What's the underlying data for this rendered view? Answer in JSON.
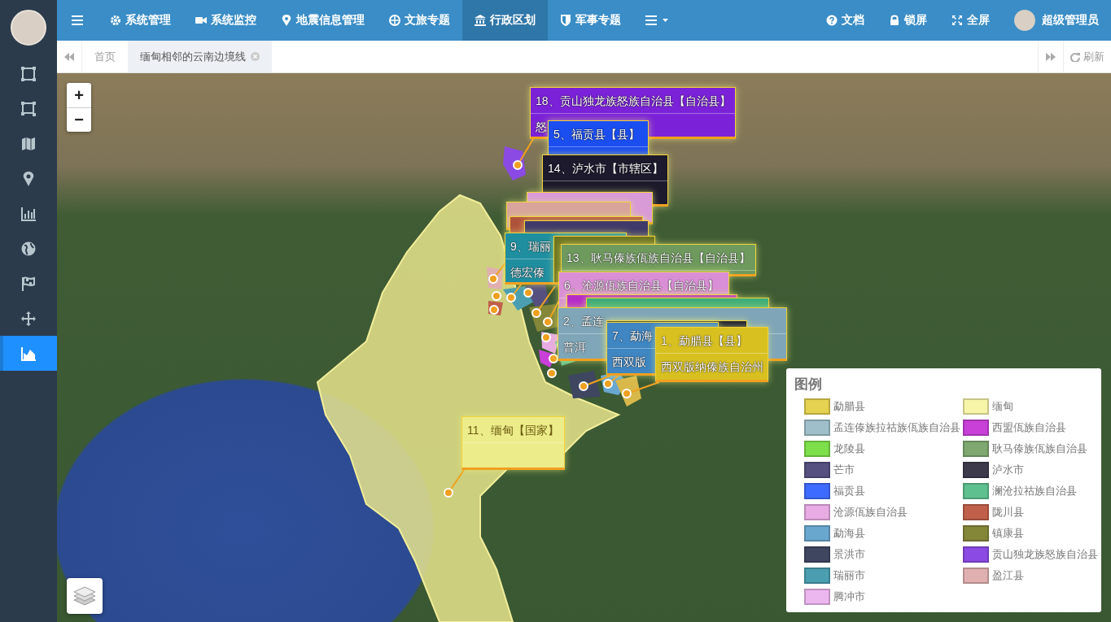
{
  "sidebar": {
    "items": [
      {
        "selected": false
      },
      {
        "selected": false
      },
      {
        "selected": false
      },
      {
        "selected": false
      },
      {
        "selected": false
      },
      {
        "selected": false
      },
      {
        "selected": false
      },
      {
        "selected": false
      },
      {
        "selected": true
      }
    ]
  },
  "topbar": {
    "menu_items": [
      {
        "label": "系统管理",
        "selected": false
      },
      {
        "label": "系统监控",
        "selected": false
      },
      {
        "label": "地震信息管理",
        "selected": false
      },
      {
        "label": "文旅专题",
        "selected": false
      },
      {
        "label": "行政区划",
        "selected": true
      },
      {
        "label": "军事专题",
        "selected": false
      }
    ],
    "right_links": [
      "文档",
      "锁屏",
      "全屏"
    ],
    "user": {
      "name": "超级管理员"
    }
  },
  "tabbar": {
    "tabs": [
      {
        "label": "首页",
        "selected": false,
        "closable": false
      },
      {
        "label": "缅甸相邻的云南边境线",
        "selected": true,
        "closable": true
      }
    ],
    "refresh": "刷新"
  },
  "map": {
    "zoom_in": "+",
    "zoom_out": "−",
    "popups": [
      {
        "title": "18、贡山独龙族怒族自治县【自治县】",
        "subtitle": "怒",
        "color": "#7b22d8"
      },
      {
        "title": "5、福贡县【县】",
        "color": "#1a4ef0"
      },
      {
        "title": "14、泸水市【市辖区】",
        "color": "#1c1a2c"
      },
      {
        "color": "#d99ad8"
      },
      {
        "color": "#d8a49c"
      },
      {
        "color": "#b0523c"
      },
      {
        "color": "#3f3a6a"
      },
      {
        "title": "9、瑞丽",
        "subtitle": "德宏傣",
        "color": "#1f8fa0"
      },
      {
        "color": "#6e7420"
      },
      {
        "title": "13、耿马傣族佤族自治县【自治县】",
        "color": "#6f9a5e"
      },
      {
        "title": "6、沧源佤族自治县【自治县】",
        "color": "#d98fd6"
      },
      {
        "color": "#b52cc8"
      },
      {
        "color": "#3fae78"
      },
      {
        "title": "2、孟连",
        "subtitle": "普洱",
        "color": "#7fa6b8"
      },
      {
        "color": "#1e2232"
      },
      {
        "title": "7、勐海",
        "subtitle": "西双版",
        "color": "#3f86c2"
      },
      {
        "title": "1、勐腊县【县】",
        "subtitle": "西双版纳傣族自治州",
        "color": "#d8c020"
      },
      {
        "title": "11、缅甸【国家】",
        "color": "#ecec8a"
      }
    ],
    "legend": {
      "title": "图例",
      "items": [
        {
          "label": "勐腊县",
          "color": "#e5d250"
        },
        {
          "label": "缅甸",
          "color": "#f7f5a8"
        },
        {
          "label": "孟连傣族拉祜族佤族自治县",
          "color": "#9fbfcb"
        },
        {
          "label": "西盟佤族自治县",
          "color": "#c840d8"
        },
        {
          "label": "龙陵县",
          "color": "#7ddf4a"
        },
        {
          "label": "耿马傣族佤族自治县",
          "color": "#7fa870"
        },
        {
          "label": "芒市",
          "color": "#55507f"
        },
        {
          "label": "泸水市",
          "color": "#3d3a4c"
        },
        {
          "label": "福贡县",
          "color": "#3d6bff"
        },
        {
          "label": "澜沧拉祜族自治县",
          "color": "#5ec08e"
        },
        {
          "label": "沧源佤族自治县",
          "color": "#e8abe4"
        },
        {
          "label": "陇川县",
          "color": "#c0604a"
        },
        {
          "label": "勐海县",
          "color": "#6aa7cf"
        },
        {
          "label": "镇康县",
          "color": "#848638"
        },
        {
          "label": "景洪市",
          "color": "#3f4660"
        },
        {
          "label": "贡山独龙族怒族自治县",
          "color": "#8b4ae3"
        },
        {
          "label": "瑞丽市",
          "color": "#4a9eb0"
        },
        {
          "label": "盈江县",
          "color": "#e0b0b0"
        },
        {
          "label": "腾冲市",
          "color": "#ecb6ef"
        }
      ]
    }
  }
}
